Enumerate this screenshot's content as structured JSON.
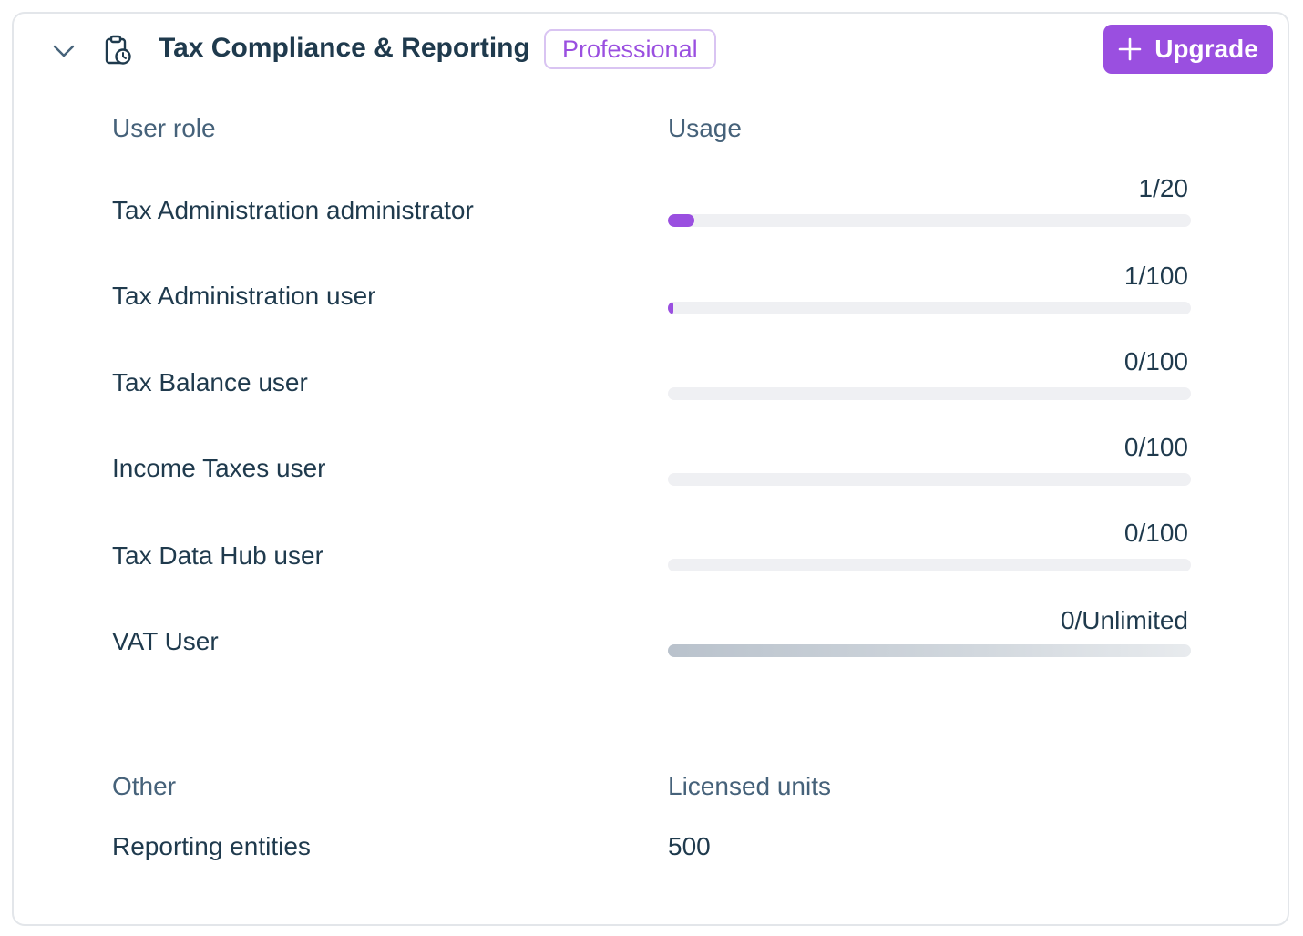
{
  "header": {
    "title": "Tax Compliance & Reporting",
    "tier": "Professional",
    "upgrade_label": "Upgrade",
    "icons": {
      "collapse": "chevron-down-icon",
      "section": "clipboard-clock-icon",
      "add": "plus-icon"
    }
  },
  "colors": {
    "accent": "#9a4fe0",
    "badge_border": "#d9c4f2",
    "track": "#eff0f3",
    "text": "#1f3a4d",
    "muted": "#46627a"
  },
  "roles_table": {
    "headers": {
      "role": "User role",
      "usage": "Usage"
    },
    "rows": [
      {
        "role": "Tax Administration administrator",
        "usage": "1/20",
        "used": 1,
        "limit": 20
      },
      {
        "role": "Tax Administration user",
        "usage": "1/100",
        "used": 1,
        "limit": 100
      },
      {
        "role": "Tax Balance user",
        "usage": "0/100",
        "used": 0,
        "limit": 100
      },
      {
        "role": "Income Taxes user",
        "usage": "0/100",
        "used": 0,
        "limit": 100
      },
      {
        "role": "Tax Data Hub user",
        "usage": "0/100",
        "used": 0,
        "limit": 100
      },
      {
        "role": "VAT User",
        "usage": "0/Unlimited",
        "used": 0,
        "limit": "Unlimited"
      }
    ]
  },
  "other_table": {
    "headers": {
      "other": "Other",
      "units": "Licensed units"
    },
    "rows": [
      {
        "item": "Reporting entities",
        "units": "500"
      }
    ]
  }
}
